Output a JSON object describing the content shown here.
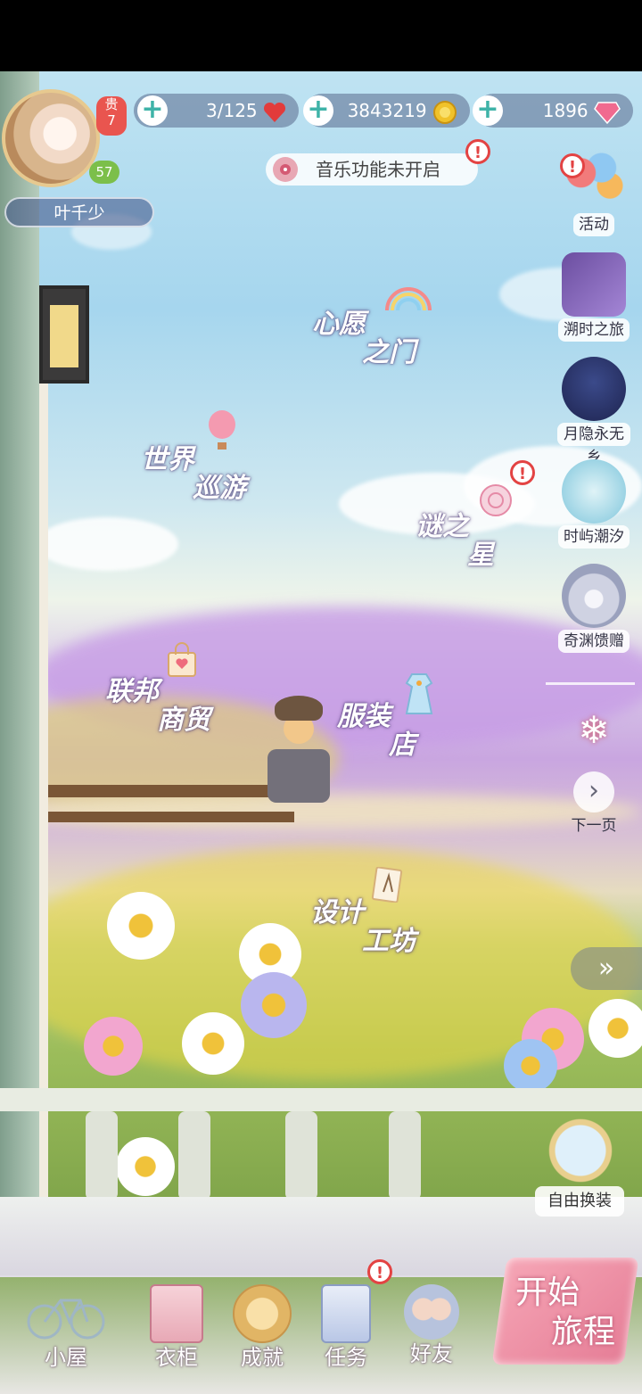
{
  "player": {
    "name": "叶千少",
    "vip_prefix": "贵",
    "vip_level": "7",
    "level": "57"
  },
  "resources": {
    "stamina": "3/125",
    "gold": "3843219",
    "diamonds": "1896"
  },
  "music_banner": "音乐功能未开启",
  "right_menu": [
    {
      "label": "活动",
      "icon": "balloons-icon"
    },
    {
      "label": "溯时之旅",
      "icon": "pixel-heart-icon"
    },
    {
      "label": "月隐永无乡",
      "icon": "moon-castle-icon"
    },
    {
      "label": "时屿潮汐",
      "icon": "sea-scroll-icon"
    },
    {
      "label": "奇渊馈赠",
      "icon": "pearl-shell-icon"
    }
  ],
  "next_page": "下一页",
  "locations": {
    "wish_gate": [
      "心愿",
      "之门"
    ],
    "world_tour": [
      "世界",
      "巡游"
    ],
    "mystery_star": [
      "谜之",
      "星"
    ],
    "federation_trade": [
      "联邦",
      "商贸"
    ],
    "clothing_store": [
      "服装",
      "店"
    ],
    "design_workshop": [
      "设计",
      "工坊"
    ]
  },
  "free_dressup": "自由换装",
  "bottom_nav": [
    {
      "label": "小屋",
      "icon": "bicycle-icon"
    },
    {
      "label": "衣柜",
      "icon": "wardrobe-icon"
    },
    {
      "label": "成就",
      "icon": "medal-icon"
    },
    {
      "label": "任务",
      "icon": "task-list-icon"
    },
    {
      "label": "好友",
      "icon": "friends-icon"
    }
  ],
  "start_journey": [
    "开始",
    "旅程"
  ],
  "colors": {
    "accent_pink": "#e57d96",
    "resource_bar": "#5a698c",
    "alert_red": "#e34343",
    "plus_teal": "#3fb3a8"
  }
}
